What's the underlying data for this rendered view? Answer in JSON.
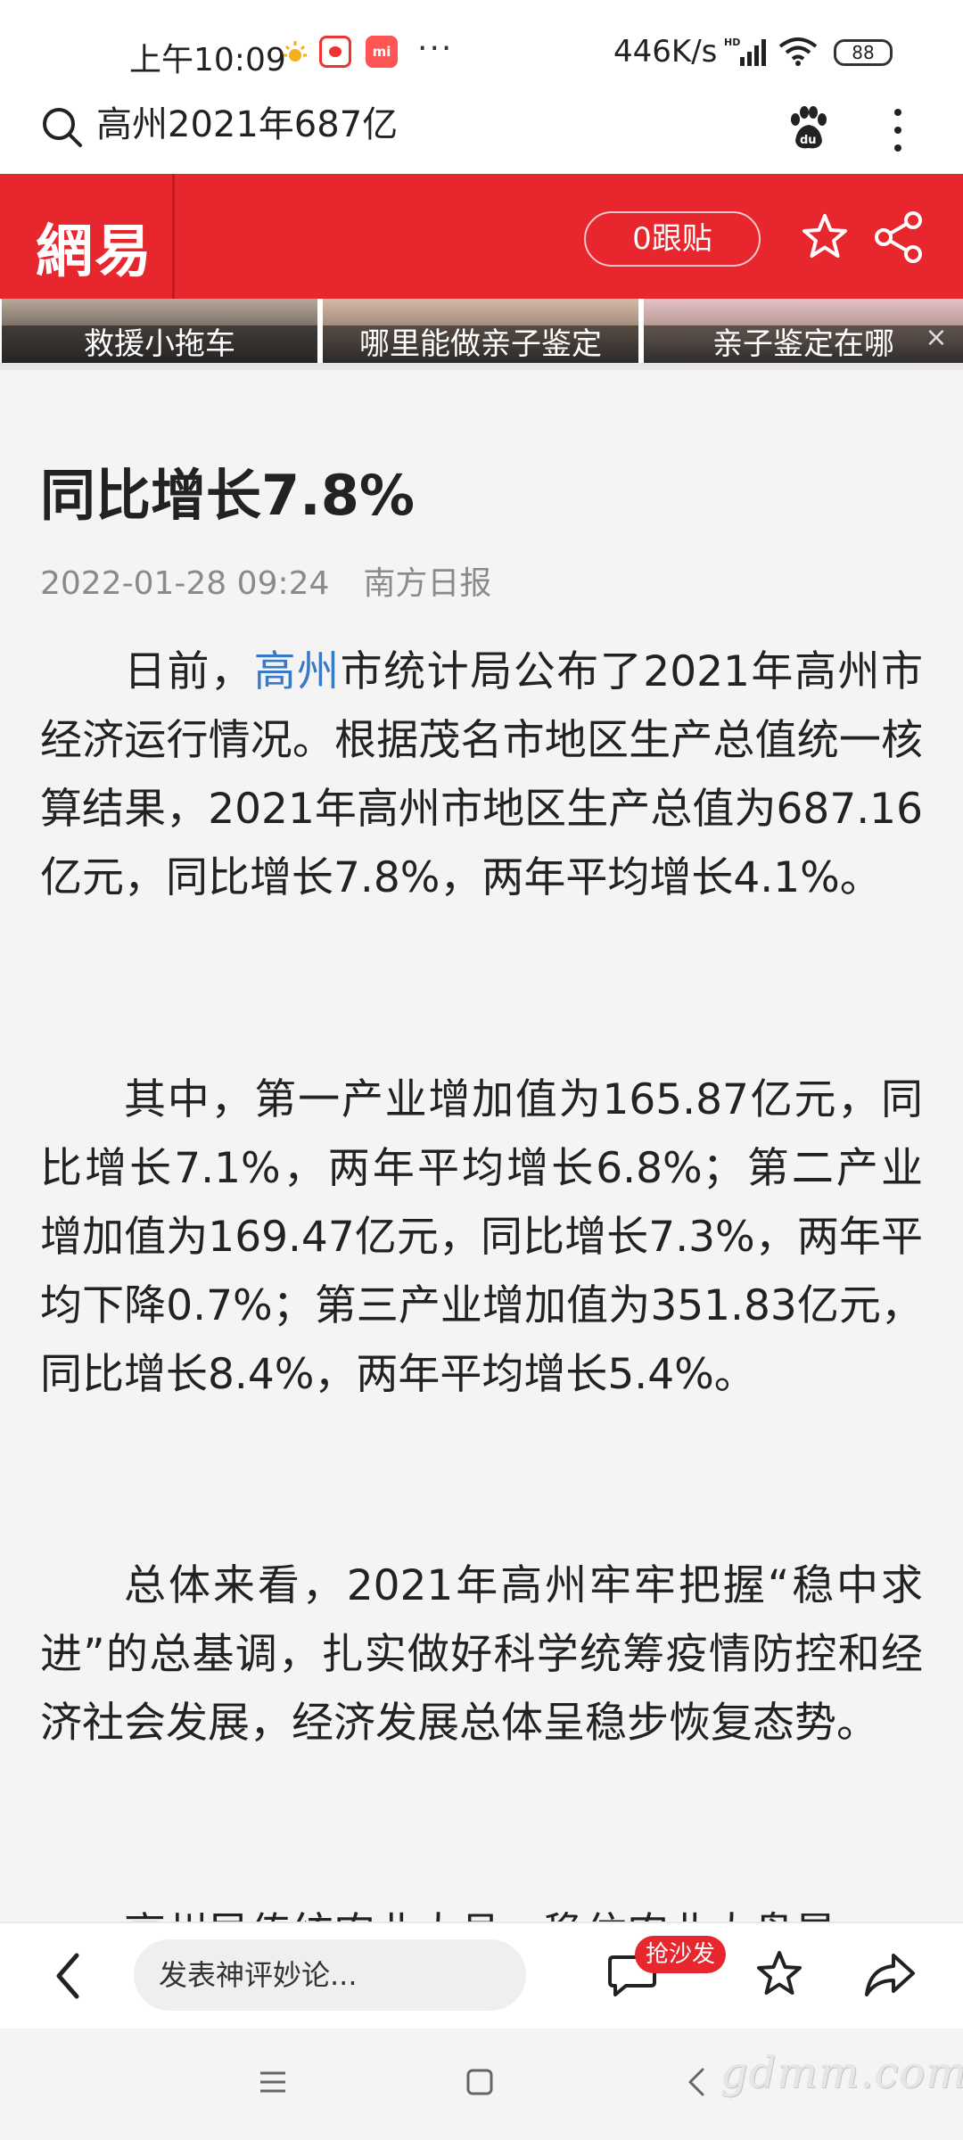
{
  "status_bar": {
    "time": "上午10:09",
    "app_badge": "mi",
    "more": "···",
    "speed": "446K/s",
    "battery": "88"
  },
  "search_bar": {
    "query": "高州2021年687亿"
  },
  "header": {
    "logo": "網易",
    "comment_count": "0跟贴",
    "brand_color": "#e8262d"
  },
  "ads": {
    "tiles": [
      {
        "caption": "救援小拖车"
      },
      {
        "caption": "哪里能做亲子鉴定"
      },
      {
        "caption": "亲子鉴定在哪"
      }
    ],
    "close": "×"
  },
  "article": {
    "title": "同比增长7.8%",
    "date": "2022-01-28 09:24",
    "source": "南方日报",
    "p1_before": "日前，",
    "p1_link": "高州",
    "p1_after": "市统计局公布了2021年高州市经济运行情况。根据茂名市地区生产总值统一核算结果，2021年高州市地区生产总值为687.16亿元，同比增长7.8%，两年平均增长4.1%。",
    "p2": "其中，第一产业增加值为165.87亿元，同比增长7.1%，两年平均增长6.8%；第二产业增加值为169.47亿元，同比增长7.3%，两年平均下降0.7%；第三产业增加值为351.83亿元，同比增长8.4%，两年平均增长5.4%。",
    "p3": "总体来看，2021年高州牢牢把握“稳中求进”的总基调，扎实做好科学统筹疫情防控和经济社会发展，经济发展总体呈稳步恢复态势。",
    "p4": "高州导传统农业大县，稳住农业大盘是",
    "link_color": "#3a78c8"
  },
  "bottom_bar": {
    "comment_placeholder": "发表神评妙论...",
    "sofa_badge": "抢沙发"
  },
  "nav_bar": {
    "watermark": "gdmm.com"
  }
}
